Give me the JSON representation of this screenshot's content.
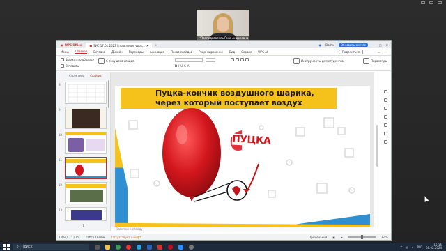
{
  "meeting": {
    "participant_name": "Преподаватель Рена Андреевна"
  },
  "app": {
    "brand": "WPS Office",
    "doc_tab": "ЗИС 17.01.2023 Управление урок...",
    "menu": [
      "Меню",
      "Главная",
      "Вставка",
      "Дизайн",
      "Переходы",
      "Анимация",
      "Показ слайдов",
      "Рецензирование",
      "Вид",
      "Сервис",
      "WPS AI"
    ],
    "active_menu": "Главная",
    "share_label": "Поделиться",
    "account_label": "Войти",
    "update_label": "Обновить сейчас"
  },
  "ribbon": {
    "format_painter": "Формат по образцу",
    "paste": "Вставить",
    "new_slide": "С текущего слайда",
    "tools_for_students": "Инструменты для студентов",
    "parameters": "Параметры"
  },
  "thumbs": {
    "tabs": [
      "Структура",
      "Слайды"
    ],
    "active_tab": "Слайды",
    "numbers": [
      "8",
      "9",
      "10",
      "11",
      "12",
      "13"
    ],
    "slide10_text": "Оборудование",
    "slide11_title": "Пуцка"
  },
  "slide": {
    "title_line1": "Пуцка-кончик воздушного шарика,",
    "title_line2": "через который поступает воздух",
    "label": "ПУЦКА"
  },
  "notes_placeholder": "Заметки к слайду",
  "status": {
    "slide_counter": "Слайд 11 / 15",
    "theme": "Office Theme",
    "font_missing": "Отсутствует шрифт",
    "zoom_label": "Примечания",
    "zoom": "61%"
  },
  "taskbar": {
    "search": "Поиск",
    "lang": "РУС",
    "time": "15:15",
    "date": "20.02.2024"
  },
  "colors": {
    "accent": "#c52b2b",
    "banner": "#f4c21a",
    "balloon": "#d3161d",
    "blue": "#2f8fd1"
  }
}
